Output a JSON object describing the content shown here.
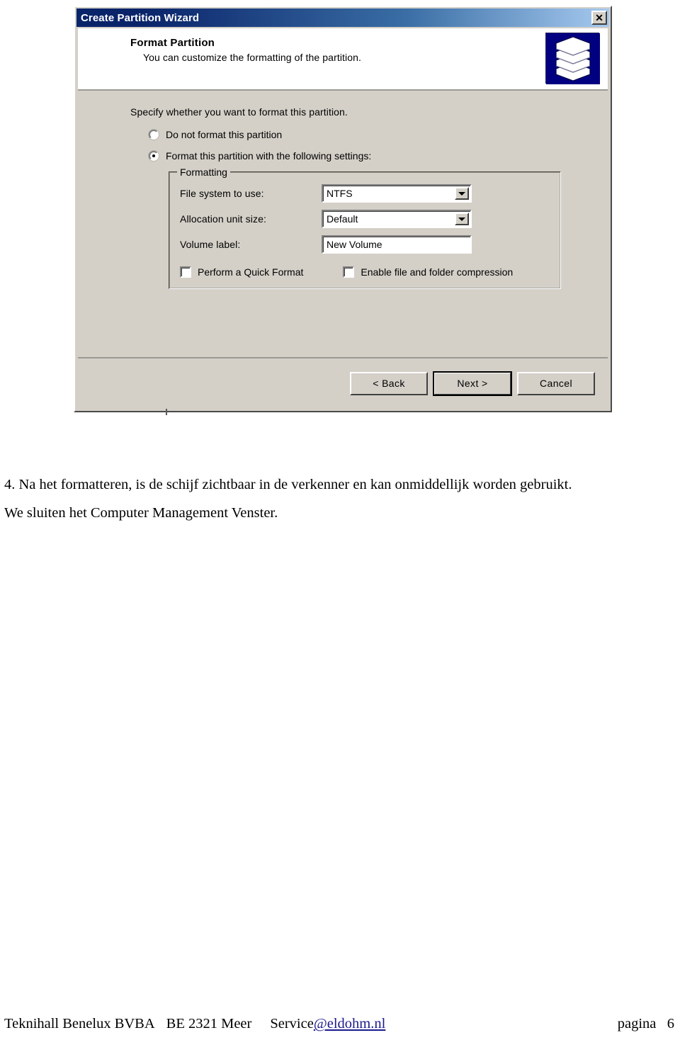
{
  "dialog": {
    "titlebar": {
      "title": "Create Partition Wizard",
      "close_label": "✕"
    },
    "header": {
      "title": "Format Partition",
      "subtitle": "You can customize the formatting of the partition.",
      "icon": "disk-stack-icon"
    },
    "body": {
      "instruction": "Specify whether you want to format this partition.",
      "radios": [
        {
          "label": "Do not format this partition",
          "checked": false
        },
        {
          "label": "Format this partition with the following settings:",
          "checked": true
        }
      ],
      "groupbox": {
        "legend": "Formatting",
        "fields": [
          {
            "label": "File system to use:",
            "value": "NTFS",
            "control": "combo"
          },
          {
            "label": "Allocation unit size:",
            "value": "Default",
            "control": "combo"
          },
          {
            "label": "Volume label:",
            "value": "New Volume",
            "control": "textbox"
          }
        ],
        "checkboxes": [
          {
            "label": "Perform a Quick Format",
            "checked": false
          },
          {
            "label": "Enable file and folder compression",
            "checked": false
          }
        ]
      }
    },
    "buttons": [
      {
        "label": "< Back",
        "default": false
      },
      {
        "label": "Next >",
        "default": true
      },
      {
        "label": "Cancel",
        "default": false
      }
    ],
    "colors": {
      "face": "#d4d0c8",
      "title_start": "#0a246a",
      "title_end": "#a6caf0",
      "icon_bg": "#000080"
    }
  },
  "document": {
    "paragraph_1": "4. Na het formatteren, is de schijf zichtbaar in de verkenner en kan onmiddellijk worden gebruikt.",
    "paragraph_2": "We sluiten het Computer Management Venster."
  },
  "footer": {
    "organisation": "Teknihall Benelux BVBA",
    "address": "BE 2321 Meer",
    "mail_prefix": "Service",
    "mail_link": "@eldohm.nl",
    "page_label": "pagina   6",
    "link_color": "#1a1a8c"
  }
}
